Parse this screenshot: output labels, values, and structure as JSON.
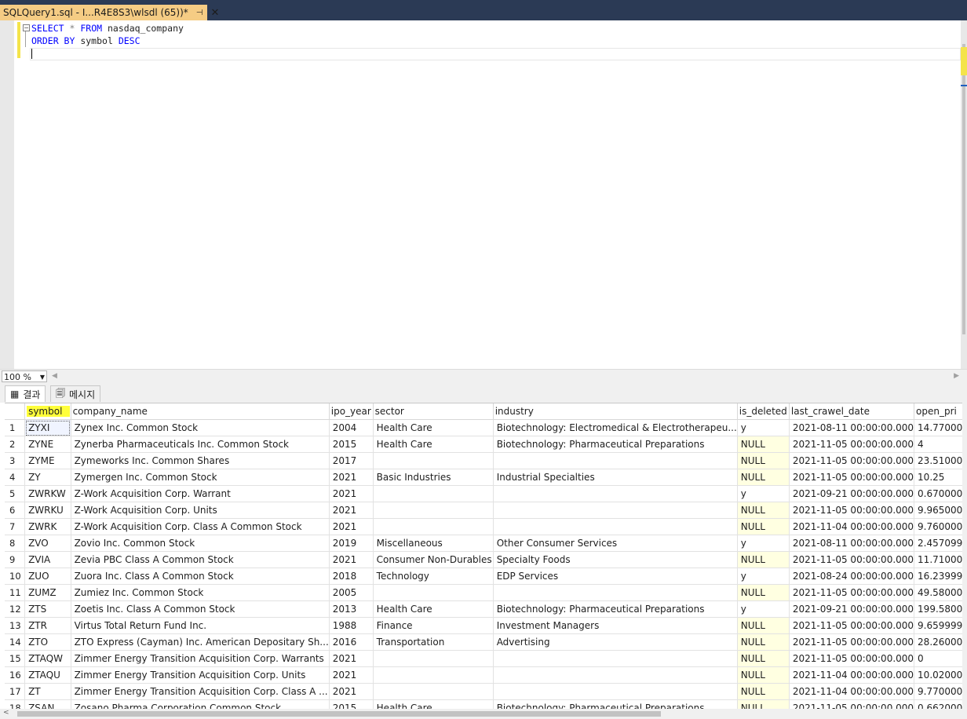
{
  "tab": {
    "title": "SQLQuery1.sql - I...R4E8S3\\wlsdl (65))*",
    "pin": "⊣",
    "close": "✕"
  },
  "editor": {
    "line1": {
      "kw1": "SELECT",
      "op": "*",
      "kw2": "FROM",
      "table": "nasdaq_company"
    },
    "line2": {
      "kw1": "ORDER BY",
      "col": "symbol",
      "kw2": "DESC"
    }
  },
  "zoom": {
    "value": "100 %"
  },
  "result_tabs": {
    "results": "결과",
    "messages": "메시지"
  },
  "grid": {
    "columns": [
      "symbol",
      "company_name",
      "ipo_year",
      "sector",
      "industry",
      "is_deleted",
      "last_crawel_date",
      "open_pri"
    ],
    "rows": [
      [
        "1",
        "ZYXI",
        "Zynex Inc. Common Stock",
        "2004",
        "Health Care",
        "Biotechnology: Electromedical & Electrotherapeu...",
        "y",
        "2021-08-11 00:00:00.000",
        "14.77000"
      ],
      [
        "2",
        "ZYNE",
        "Zynerba Pharmaceuticals Inc. Common Stock",
        "2015",
        "Health Care",
        "Biotechnology: Pharmaceutical Preparations",
        "NULL",
        "2021-11-05 00:00:00.000",
        "4"
      ],
      [
        "3",
        "ZYME",
        "Zymeworks Inc. Common Shares",
        "2017",
        "",
        "",
        "NULL",
        "2021-11-05 00:00:00.000",
        "23.51000"
      ],
      [
        "4",
        "ZY",
        "Zymergen Inc. Common Stock",
        "2021",
        "Basic Industries",
        "Industrial Specialties",
        "NULL",
        "2021-11-05 00:00:00.000",
        "10.25"
      ],
      [
        "5",
        "ZWRKW",
        "Z-Work Acquisition Corp. Warrant",
        "2021",
        "",
        "",
        "y",
        "2021-09-21 00:00:00.000",
        "0.670000"
      ],
      [
        "6",
        "ZWRKU",
        "Z-Work Acquisition Corp. Units",
        "2021",
        "",
        "",
        "NULL",
        "2021-11-05 00:00:00.000",
        "9.965000"
      ],
      [
        "7",
        "ZWRK",
        "Z-Work Acquisition Corp. Class A Common Stock",
        "2021",
        "",
        "",
        "NULL",
        "2021-11-04 00:00:00.000",
        "9.760000"
      ],
      [
        "8",
        "ZVO",
        "Zovio Inc. Common Stock",
        "2019",
        "Miscellaneous",
        "Other Consumer Services",
        "y",
        "2021-08-11 00:00:00.000",
        "2.457099"
      ],
      [
        "9",
        "ZVIA",
        "Zevia PBC Class A Common Stock",
        "2021",
        "Consumer Non-Durables",
        "Specialty Foods",
        "NULL",
        "2021-11-05 00:00:00.000",
        "11.71000"
      ],
      [
        "10",
        "ZUO",
        "Zuora Inc. Class A Common Stock",
        "2018",
        "Technology",
        "EDP Services",
        "y",
        "2021-08-24 00:00:00.000",
        "16.23999"
      ],
      [
        "11",
        "ZUMZ",
        "Zumiez Inc. Common Stock",
        "2005",
        "",
        "",
        "NULL",
        "2021-11-05 00:00:00.000",
        "49.58000"
      ],
      [
        "12",
        "ZTS",
        "Zoetis Inc. Class A Common Stock",
        "2013",
        "Health Care",
        "Biotechnology: Pharmaceutical Preparations",
        "y",
        "2021-09-21 00:00:00.000",
        "199.5800"
      ],
      [
        "13",
        "ZTR",
        "Virtus Total Return Fund Inc.",
        "1988",
        "Finance",
        "Investment Managers",
        "NULL",
        "2021-11-05 00:00:00.000",
        "9.659999"
      ],
      [
        "14",
        "ZTO",
        "ZTO Express (Cayman) Inc. American Depositary Sh...",
        "2016",
        "Transportation",
        "Advertising",
        "NULL",
        "2021-11-05 00:00:00.000",
        "28.26000"
      ],
      [
        "15",
        "ZTAQW",
        "Zimmer Energy Transition Acquisition Corp. Warrants",
        "2021",
        "",
        "",
        "NULL",
        "2021-11-05 00:00:00.000",
        "0"
      ],
      [
        "16",
        "ZTAQU",
        "Zimmer Energy Transition Acquisition Corp. Units",
        "2021",
        "",
        "",
        "NULL",
        "2021-11-04 00:00:00.000",
        "10.02000"
      ],
      [
        "17",
        "ZT",
        "Zimmer Energy Transition Acquisition Corp. Class A ...",
        "2021",
        "",
        "",
        "NULL",
        "2021-11-04 00:00:00.000",
        "9.770000"
      ],
      [
        "18",
        "ZSAN",
        "Zosano Pharma Corporation Common Stock",
        "2015",
        "Health Care",
        "Biotechnology: Pharmaceutical Preparations",
        "NULL",
        "2021-11-05 00:00:00.000",
        "0.662000"
      ]
    ]
  },
  "colors": {
    "tabstrip": "#2b3a55",
    "active_tab": "#f5cc84",
    "keyword": "#0000ff",
    "null_cell": "#ffffe1",
    "highlight": "#ffff3a"
  }
}
